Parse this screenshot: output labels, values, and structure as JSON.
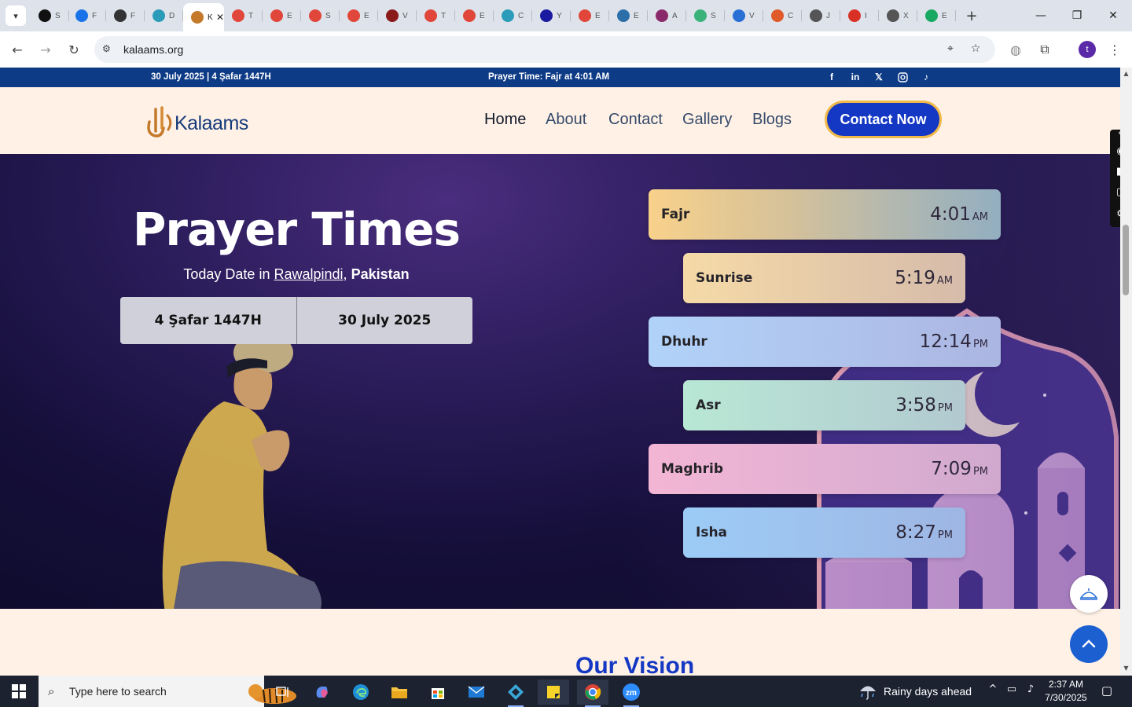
{
  "browser": {
    "tabs": [
      {
        "title": "S",
        "color": "#111111"
      },
      {
        "title": "F",
        "color": "#1a73e8"
      },
      {
        "title": "F",
        "color": "#333333"
      },
      {
        "title": "D",
        "color": "#2a9bb8"
      },
      {
        "title": "K",
        "color": "#c47a2a",
        "active": true
      },
      {
        "title": "T",
        "color": "#e0463a"
      },
      {
        "title": "E",
        "color": "#e0463a"
      },
      {
        "title": "S",
        "color": "#e0463a"
      },
      {
        "title": "E",
        "color": "#e0463a"
      },
      {
        "title": "V",
        "color": "#8b1a1a"
      },
      {
        "title": "T",
        "color": "#e0463a"
      },
      {
        "title": "E",
        "color": "#e0463a"
      },
      {
        "title": "C",
        "color": "#2a9bb8"
      },
      {
        "title": "Y",
        "color": "#1a1aa0"
      },
      {
        "title": "E",
        "color": "#e0463a"
      },
      {
        "title": "E",
        "color": "#2c6fa8"
      },
      {
        "title": "A",
        "color": "#8b2a6a"
      },
      {
        "title": "S",
        "color": "#3ab27a"
      },
      {
        "title": "V",
        "color": "#2a6fd6"
      },
      {
        "title": "C",
        "color": "#e05a2a"
      },
      {
        "title": "J",
        "color": "#555555"
      },
      {
        "title": "I",
        "color": "#d93025"
      },
      {
        "title": "X",
        "color": "#555555"
      },
      {
        "title": "E",
        "color": "#18a860"
      }
    ],
    "url": "kalaams.org",
    "avatar_letter": "t"
  },
  "topbar": {
    "date_text": "30 July 2025 | 4 Şafar 1447H",
    "prayer_text": "Prayer Time: Fajr at 4:01 AM",
    "social": [
      "facebook-icon",
      "linkedin-icon",
      "x-icon",
      "instagram-icon",
      "tiktok-icon"
    ]
  },
  "nav": {
    "logo_text": "Kalaams",
    "links": [
      "Home",
      "About",
      "Contact",
      "Gallery",
      "Blogs"
    ],
    "active": "Home",
    "cta_label": "Contact Now",
    "accent": "#1438c4",
    "cta_border": "#f0b94a"
  },
  "hero": {
    "title": "Prayer Times",
    "sub_prefix": "Today Date in ",
    "city": "Rawalpindi",
    "comma": ",",
    "country": "Pakistan",
    "hijri_date": "4 Şafar 1447H",
    "gregorian_date": "30 July 2025"
  },
  "prayers": [
    {
      "name": "Fajr",
      "time": "4:01",
      "ampm": "AM",
      "gradient": "linear-gradient(90deg,#fcd58a 0%,#e6d39a 40%,#a8d8d0 100%)"
    },
    {
      "name": "Sunrise",
      "time": "5:19",
      "ampm": "AM",
      "gradient": "linear-gradient(90deg,#fde2a8 0%,#fde4b0 100%)"
    },
    {
      "name": "Dhuhr",
      "time": "12:14",
      "ampm": "PM",
      "gradient": "linear-gradient(90deg,#b3d6fb 0%,#c8e1fc 100%)"
    },
    {
      "name": "Asr",
      "time": "3:58",
      "ampm": "PM",
      "gradient": "linear-gradient(90deg,#bdf0d8 0%,#cdf6e2 100%)"
    },
    {
      "name": "Maghrib",
      "time": "7:09",
      "ampm": "PM",
      "gradient": "linear-gradient(90deg,#f7b8d6 0%,#fbd0e4 100%)"
    },
    {
      "name": "Isha",
      "time": "8:27",
      "ampm": "PM",
      "gradient": "linear-gradient(90deg,#9fd3fb 0%,#b4dcfc 100%)"
    }
  ],
  "vision": {
    "heading": "Our Vision"
  },
  "taskbar": {
    "search_placeholder": "Type here to search",
    "weather": "Rainy days ahead",
    "time": "2:37 AM",
    "date": "7/30/2025"
  }
}
